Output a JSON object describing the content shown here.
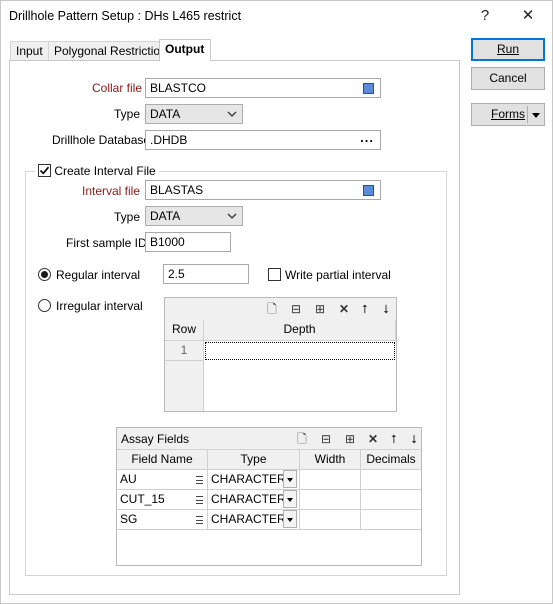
{
  "window": {
    "title": "Drillhole Pattern Setup : DHs L465 restrict",
    "help_label": "?",
    "close_label": "✕"
  },
  "tabs": [
    {
      "label": "Input"
    },
    {
      "label": "Polygonal Restriction"
    },
    {
      "label": "Output"
    }
  ],
  "buttons": {
    "run": "Run",
    "cancel": "Cancel",
    "forms": "Forms"
  },
  "collar": {
    "file_label": "Collar file",
    "file_value": "BLASTCO",
    "type_label": "Type",
    "type_value": "DATA",
    "db_label": "Drillhole Database",
    "db_value": ".DHDB",
    "browse": "..."
  },
  "interval": {
    "create_label": "Create Interval File",
    "file_label": "Interval file",
    "file_value": "BLASTAS",
    "type_label": "Type",
    "type_value": "DATA",
    "first_id_label": "First sample ID",
    "first_id_value": "B1000",
    "regular_label": "Regular interval",
    "regular_value": "2.5",
    "partial_label": "Write partial interval",
    "irregular_label": "Irregular interval"
  },
  "depth_grid": {
    "headers": {
      "row": "Row",
      "depth": "Depth"
    },
    "rows": [
      {
        "row": "1",
        "depth": ""
      }
    ]
  },
  "assay": {
    "title": "Assay Fields",
    "headers": {
      "name": "Field Name",
      "type": "Type",
      "width": "Width",
      "decimals": "Decimals"
    },
    "rows": [
      {
        "name": "AU",
        "type": "CHARACTER",
        "width": "",
        "decimals": ""
      },
      {
        "name": "CUT_15",
        "type": "CHARACTER",
        "width": "",
        "decimals": ""
      },
      {
        "name": "SG",
        "type": "CHARACTER",
        "width": "",
        "decimals": ""
      }
    ]
  }
}
